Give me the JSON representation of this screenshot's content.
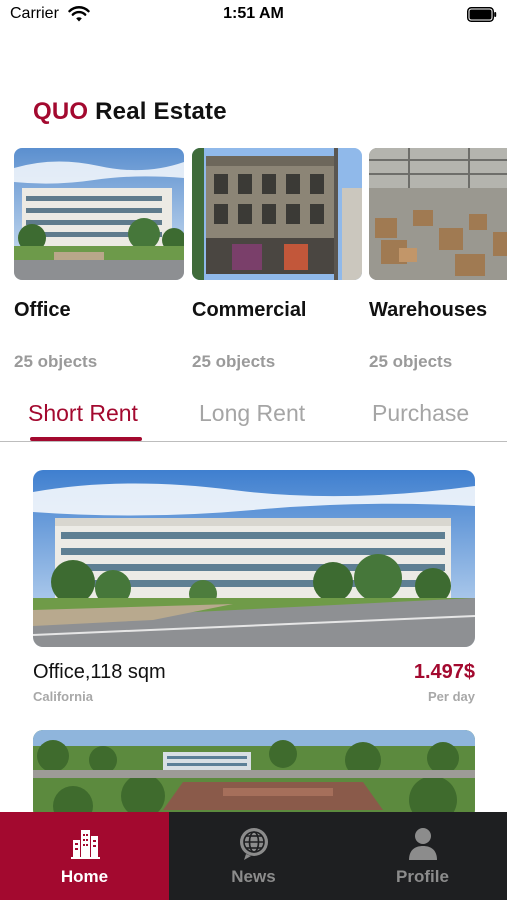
{
  "status_bar": {
    "carrier": "Carrier",
    "time": "1:51 AM",
    "icons": [
      "wifi-icon",
      "battery-icon"
    ]
  },
  "brand": {
    "accent": "QUO",
    "rest": " Real Estate"
  },
  "categories": [
    {
      "title": "Office",
      "count": "25 objects",
      "image": "office-building-photo"
    },
    {
      "title": "Commercial",
      "count": "25 objects",
      "image": "commercial-building-photo"
    },
    {
      "title": "Warehouses",
      "count": "25 objects",
      "image": "warehouse-interior-photo"
    }
  ],
  "tabs": [
    {
      "label": "Short Rent",
      "active": true
    },
    {
      "label": "Long Rent",
      "active": false
    },
    {
      "label": "Purchase",
      "active": false
    }
  ],
  "listings": [
    {
      "title": "Office,118 sqm",
      "location": "California",
      "price": "1.497$",
      "unit": "Per day",
      "image": "office-campus-photo"
    },
    {
      "image": "aerial-office-photo"
    }
  ],
  "bottom_nav": [
    {
      "label": "Home",
      "icon": "buildings-icon",
      "active": true
    },
    {
      "label": "News",
      "icon": "globe-icon",
      "active": false
    },
    {
      "label": "Profile",
      "icon": "user-icon",
      "active": false
    }
  ],
  "colors": {
    "accent": "#A3092F",
    "nav_background": "#1e1f21",
    "muted_text": "#a5a5a5"
  }
}
